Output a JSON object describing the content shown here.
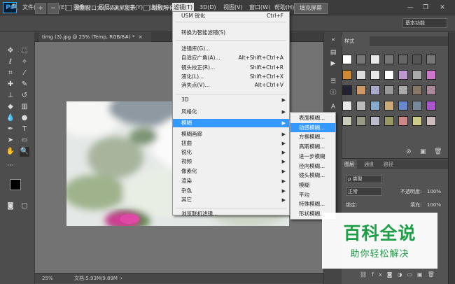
{
  "app": {
    "logo": "Ps"
  },
  "menubar": [
    {
      "label": "文件(F)"
    },
    {
      "label": "编辑(E)"
    },
    {
      "label": "图像(I)"
    },
    {
      "label": "图层(L)"
    },
    {
      "label": "文字(Y)"
    },
    {
      "label": "选择(S)"
    },
    {
      "label": "滤镜(T)"
    },
    {
      "label": "3D(D)"
    },
    {
      "label": "视图(V)"
    },
    {
      "label": "窗口(W)"
    },
    {
      "label": "帮助(H)"
    }
  ],
  "window_controls": {
    "minimize": "—",
    "restore": "❐",
    "close": "✕"
  },
  "options": {
    "fit_window_label": "调整窗口大小以满屏显示",
    "zoom_all_label": "缩放所有",
    "fill_screen_label": "填充屏幕",
    "workspace": "基本功能"
  },
  "document": {
    "tab_title": "timg (3).jpg @ 25% (Temp, RGB/8#) *",
    "close": "×"
  },
  "status": {
    "zoom": "25%",
    "doc_size": "文档:5.93M/9.89M"
  },
  "filter_menu": [
    {
      "label": "USM 锐化",
      "shortcut": "Ctrl+F"
    },
    {
      "separator": true
    },
    {
      "label": "转换为智能滤镜(S)"
    },
    {
      "separator": true
    },
    {
      "label": "滤镜库(G)..."
    },
    {
      "label": "自适应广角(A)...",
      "shortcut": "Alt+Shift+Ctrl+A"
    },
    {
      "label": "镜头校正(R)...",
      "shortcut": "Shift+Ctrl+R"
    },
    {
      "label": "液化(L)...",
      "shortcut": "Shift+Ctrl+X"
    },
    {
      "label": "消失点(V)...",
      "shortcut": "Alt+Ctrl+V"
    },
    {
      "separator": true
    },
    {
      "label": "3D",
      "submenu": true
    },
    {
      "label": "风格化",
      "submenu": true
    },
    {
      "label": "模糊",
      "submenu": true,
      "highlighted": true
    },
    {
      "label": "模糊画廊",
      "submenu": true
    },
    {
      "label": "扭曲",
      "submenu": true
    },
    {
      "label": "锐化",
      "submenu": true
    },
    {
      "label": "视频",
      "submenu": true
    },
    {
      "label": "像素化",
      "submenu": true
    },
    {
      "label": "渲染",
      "submenu": true
    },
    {
      "label": "杂色",
      "submenu": true
    },
    {
      "label": "其它",
      "submenu": true
    },
    {
      "separator": true
    },
    {
      "label": "浏览联机滤镜..."
    }
  ],
  "blur_submenu": [
    {
      "label": "表面模糊..."
    },
    {
      "label": "动感模糊...",
      "highlighted": true
    },
    {
      "label": "方框模糊..."
    },
    {
      "label": "高斯模糊..."
    },
    {
      "label": "进一步模糊"
    },
    {
      "label": "径向模糊..."
    },
    {
      "label": "镜头模糊..."
    },
    {
      "label": "模糊"
    },
    {
      "label": "平均"
    },
    {
      "label": "特殊模糊..."
    },
    {
      "label": "形状模糊..."
    }
  ],
  "styles_panel": {
    "tab": "样式"
  },
  "layers_panel": {
    "tabs": [
      "图层",
      "通道",
      "路径"
    ],
    "kind_filter": "类型",
    "blend_mode": "正常",
    "opacity_label": "不透明度:",
    "opacity_value": "100%",
    "lock_label": "锁定:",
    "fill_label": "填充:",
    "fill_value": "100%"
  },
  "watermark": {
    "title": "百科全说",
    "subtitle": "助你轻松解决"
  },
  "colors": {
    "accent": "#3399ff",
    "watermark_green": "#1e9e46",
    "ps_blue": "#31a8ff"
  }
}
